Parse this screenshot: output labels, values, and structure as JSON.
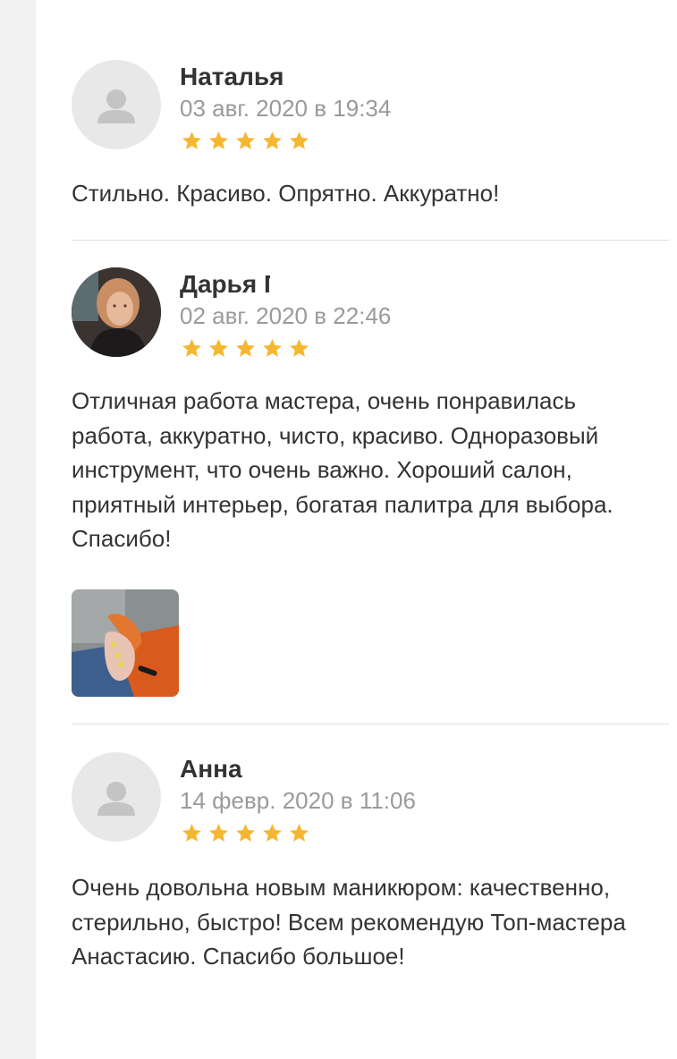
{
  "colors": {
    "star": "#f5b731",
    "name": "#333333",
    "date": "#9a9a9a",
    "divider": "#dedede"
  },
  "reviews": [
    {
      "author": "Наталья",
      "date": "03 авг. 2020 в 19:34",
      "rating": 5,
      "text": "Стильно. Красиво. Опрятно. Аккуратно!",
      "avatar": "user-placeholder-icon"
    },
    {
      "author": "Дарья Г",
      "date": "02 авг. 2020 в 22:46",
      "rating": 5,
      "text": "Отличная работа мастера, очень понравилась работа, аккуратно, чисто, красиво. Одноразовый инструмент, что очень важно. Хороший салон, приятный интерьер, богатая палитра для выбора. Спасибо!",
      "avatar": "user-photo",
      "attachment": "manicure-photo"
    },
    {
      "author": "Анна",
      "date": "14 февр. 2020 в 11:06",
      "rating": 5,
      "text": "Очень довольна новым маникюром: качественно, стерильно, быстро! Всем рекомендую Топ-мастера Анастасию. Спасибо большое!",
      "avatar": "user-placeholder-icon"
    }
  ]
}
